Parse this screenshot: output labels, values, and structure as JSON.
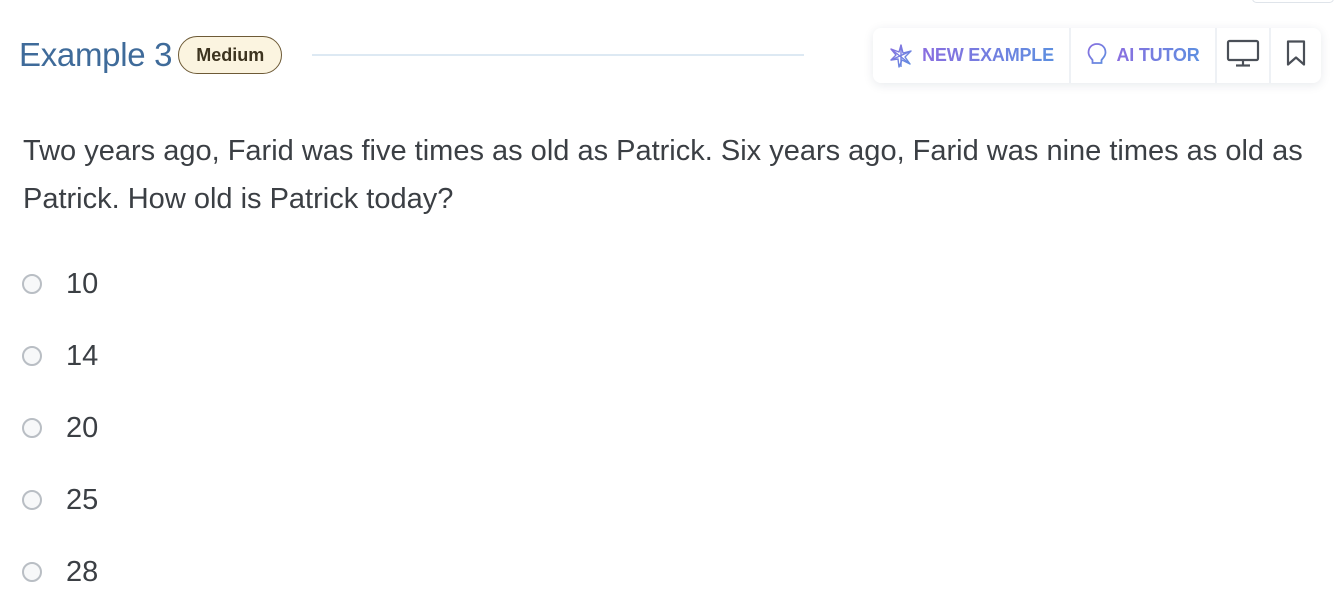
{
  "header": {
    "title": "Example 3",
    "difficulty_badge": "Medium"
  },
  "toolbar": {
    "new_example_label": "NEW EXAMPLE",
    "ai_tutor_label": "AI TUTOR",
    "new_example_icon": "sparkle-star-icon",
    "ai_tutor_icon": "lightbulb-icon",
    "screen_icon": "monitor-icon",
    "bookmark_icon": "bookmark-icon"
  },
  "question": {
    "text": "Two years ago, Farid was five times as old as Patrick. Six years ago, Farid was nine times as old as Patrick. How old is Patrick today?"
  },
  "options": [
    {
      "label": "10"
    },
    {
      "label": "14"
    },
    {
      "label": "20"
    },
    {
      "label": "25"
    },
    {
      "label": "28"
    }
  ],
  "colors": {
    "title": "#3f6b9a",
    "badge_background": "#fbf4e0",
    "badge_border": "#6d5a36",
    "toolbar_accent_start": "#8a6ee0",
    "toolbar_accent_end": "#5d8fe0",
    "text": "#3b3f44"
  }
}
